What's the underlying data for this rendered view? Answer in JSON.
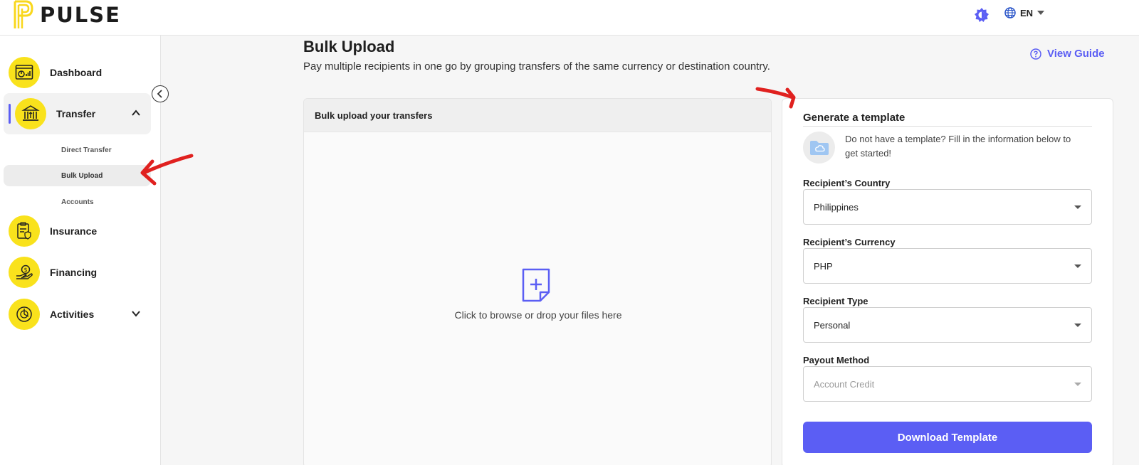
{
  "header": {
    "brand": "PULSE",
    "language": "EN",
    "icons": {
      "theme": "theme-toggle-icon",
      "language": "globe-icon"
    }
  },
  "sidebar": {
    "items": [
      {
        "key": "dashboard",
        "label": "Dashboard",
        "icon": "dashboard-icon"
      },
      {
        "key": "transfer",
        "label": "Transfer",
        "icon": "bank-transfer-icon",
        "expanded": true,
        "children": [
          {
            "label": "Direct Transfer"
          },
          {
            "label": "Bulk Upload",
            "active": true
          },
          {
            "label": "Accounts"
          }
        ]
      },
      {
        "key": "insurance",
        "label": "Insurance",
        "icon": "insurance-icon"
      },
      {
        "key": "financing",
        "label": "Financing",
        "icon": "financing-icon"
      },
      {
        "key": "activities",
        "label": "Activities",
        "icon": "activities-icon",
        "expanded": false
      }
    ]
  },
  "main": {
    "title": "Bulk Upload",
    "subtitle": "Pay multiple recipients in one go by grouping transfers of the same currency or destination country.",
    "view_guide": "View Guide",
    "upload": {
      "heading": "Bulk upload your transfers",
      "dropzone_text": "Click to browse or drop your files here"
    },
    "template": {
      "title": "Generate a template",
      "info": "Do not have a template? Fill in the information below to get started!",
      "fields": [
        {
          "label": "Recipient’s Country",
          "value": "Philippines"
        },
        {
          "label": "Recipient’s Currency",
          "value": "PHP"
        },
        {
          "label": "Recipient Type",
          "value": "Personal"
        },
        {
          "label": "Payout Method",
          "placeholder": "Account Credit"
        }
      ],
      "button": "Download Template"
    }
  },
  "colors": {
    "accent": "#5b5ef4",
    "brand_yellow": "#f9e21c",
    "annotation_red": "#e0211f"
  }
}
